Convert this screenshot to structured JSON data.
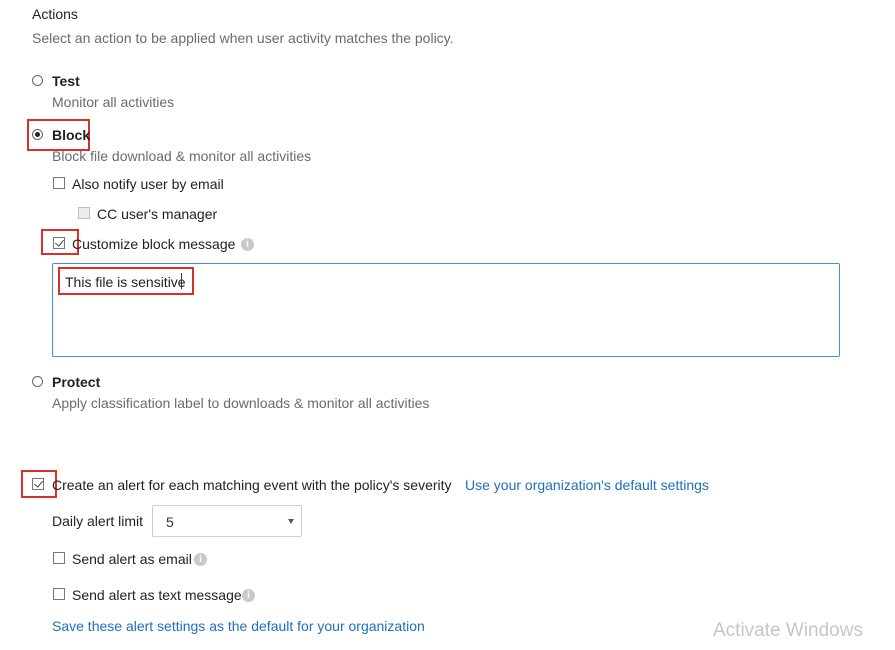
{
  "actions": {
    "title": "Actions",
    "subtitle": "Select an action to be applied when user activity matches the policy.",
    "options": [
      {
        "label": "Test",
        "description": "Monitor all activities",
        "selected": false
      },
      {
        "label": "Block",
        "description": "Block file download & monitor all activities",
        "selected": true
      },
      {
        "label": "Protect",
        "description": "Apply classification label to downloads & monitor all activities",
        "selected": false
      }
    ],
    "block": {
      "notify_email_label": "Also notify user by email",
      "notify_email_checked": false,
      "cc_manager_label": "CC user's manager",
      "cc_manager_checked": false,
      "customize_label": "Customize block message",
      "customize_checked": true,
      "message_value": "This file is sensitive"
    }
  },
  "alerts": {
    "create_alert_label": "Create an alert for each matching event with the policy's severity",
    "create_alert_checked": true,
    "default_settings_link": "Use your organization's default settings",
    "daily_limit_label": "Daily alert limit",
    "daily_limit_value": "5",
    "send_email_label": "Send alert as email",
    "send_email_checked": false,
    "send_text_label": "Send alert as text message",
    "send_text_checked": false,
    "save_default_link": "Save these alert settings as the default for your organization"
  },
  "icons": {
    "info": "i"
  },
  "watermark": {
    "title": "Activate Windows"
  },
  "colors": {
    "highlight": "#d9302c",
    "link": "#1e6fbf",
    "focus_border": "#3f8fd6"
  }
}
